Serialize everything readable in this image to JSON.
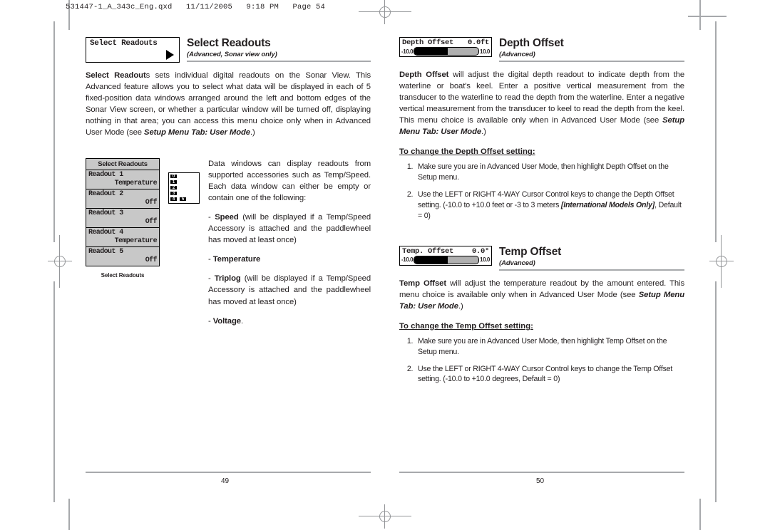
{
  "file_header": "531447-1_A_343c_Eng.qxd   11/11/2005   9:18 PM   Page 54",
  "left_page": {
    "widget": {
      "label": "Select Readouts",
      "arrow_icon": "right-triangle-icon"
    },
    "title": "Select Readouts",
    "subtitle": "(Advanced, Sonar view only)",
    "intro_html": "<b>Select Readout</b>s sets individual digital readouts on the Sonar View. This Advanced feature allows you to select what data will be displayed in each of 5 fixed-position data windows arranged around the left and bottom edges of the Sonar View screen, or whether a particular window will be turned off, displaying nothing in that area; you can access this menu choice only when in Advanced User Mode (see <span class=\"bi\">Setup Menu Tab: User Mode</span>.)",
    "figure": {
      "menu_title": "Select Readouts",
      "items": [
        {
          "label": "Readout 1",
          "value": "Temperature"
        },
        {
          "label": "Readout 2",
          "value": "Off"
        },
        {
          "label": "Readout 3",
          "value": "Off"
        },
        {
          "label": "Readout 4",
          "value": "Temperature"
        },
        {
          "label": "Readout 5",
          "value": "Off"
        }
      ],
      "caption": "Select Readouts",
      "diagram_cells": [
        "0",
        "1",
        "2",
        "3",
        "4",
        "5"
      ]
    },
    "figure_text": {
      "para1": "Data windows can display readouts from supported accessories such as Temp/Speed. Each data window can either be empty or contain one of the following:",
      "bullet_speed_html": "- <b>Speed</b> (will be displayed if a Temp/Speed Accessory is attached and the paddlewheel has moved at least once)",
      "bullet_temperature_html": "- <b>Temperature</b>",
      "bullet_triplog_html": "- <b>Triplog</b> (will be displayed if a Temp/Speed Accessory is attached and the paddlewheel has moved at least once)",
      "bullet_voltage_html": "- <b>Voltage</b>."
    },
    "page_number": "49"
  },
  "right_page": {
    "depth_offset": {
      "widget": {
        "label": "Depth Offset",
        "value": "0.0ft",
        "min_label": "-10.0",
        "max_label": "10.0"
      },
      "title": "Depth Offset",
      "subtitle": "(Advanced)",
      "body_html": "<b>Depth Offset</b> will adjust the digital depth readout to indicate depth from the waterline or boat's keel. Enter a positive vertical measurement from the transducer to the waterline to read the depth from the waterline. Enter a negative vertical measurement from the transducer to keel to read the depth from the keel. This menu choice is available only when in Advanced User Mode (see <span class=\"bi\">Setup Menu Tab: User Mode</span>.)",
      "steps_heading": "To change the Depth Offset setting:",
      "steps_html": [
        "Make sure you are in Advanced User Mode, then highlight Depth Offset on the Setup menu.",
        "Use the LEFT or RIGHT 4-WAY Cursor Control keys to change the Depth Offset setting. (-10.0 to +10.0 feet or -3 to 3 meters <span class=\"bi\">[International Models Only]</span>, Default = 0)"
      ]
    },
    "temp_offset": {
      "widget": {
        "label": "Temp. Offset",
        "value": "0.0°",
        "min_label": "-10.0",
        "max_label": "10.0"
      },
      "title": "Temp Offset",
      "subtitle": "(Advanced)",
      "body_html": "<b>Temp Offset</b> will adjust the temperature readout by the amount entered. This menu choice is available only when in Advanced User Mode (see <span class=\"bi\">Setup Menu Tab: User Mode</span>.)",
      "steps_heading": "To change the Temp Offset setting:",
      "steps_html": [
        "Make sure you are in Advanced User Mode, then highlight Temp Offset on the Setup menu.",
        "Use the LEFT or RIGHT 4-WAY Cursor Control keys to change the Temp Offset setting. (-10.0 to +10.0 degrees, Default = 0)"
      ]
    },
    "page_number": "50"
  }
}
